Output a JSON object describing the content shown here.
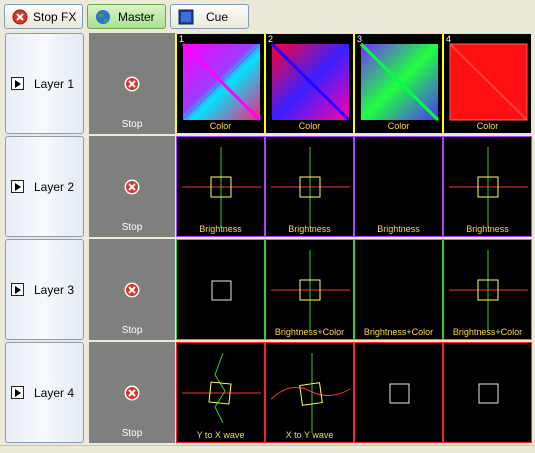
{
  "toolbar": {
    "stop_fx": "Stop FX",
    "master": "Master",
    "cue": "Cue"
  },
  "layers": [
    {
      "label": "Layer 1",
      "stop": "Stop",
      "cells": [
        {
          "num": "1",
          "label": "Color"
        },
        {
          "num": "2",
          "label": "Color"
        },
        {
          "num": "3",
          "label": "Color"
        },
        {
          "num": "4",
          "label": "Color"
        }
      ]
    },
    {
      "label": "Layer 2",
      "stop": "Stop",
      "cells": [
        {
          "label": "Brightness"
        },
        {
          "label": "Brightness"
        },
        {
          "label": "Brightness"
        },
        {
          "label": "Brightness"
        }
      ]
    },
    {
      "label": "Layer 3",
      "stop": "Stop",
      "cells": [
        {
          "label": ""
        },
        {
          "label": "Brightness+Color"
        },
        {
          "label": "Brightness+Color"
        },
        {
          "label": "Brightness+Color"
        }
      ]
    },
    {
      "label": "Layer 4",
      "stop": "Stop",
      "cells": [
        {
          "label": "Y to X wave"
        },
        {
          "label": "X to Y wave"
        },
        {
          "label": ""
        },
        {
          "label": ""
        }
      ]
    }
  ],
  "colors": {
    "layer1_border": "#ffff00",
    "layer2_border": "#b040ff",
    "layer3_border": "#30d030",
    "layer4_border": "#ff2020",
    "cell_label": "#ffd94a"
  }
}
